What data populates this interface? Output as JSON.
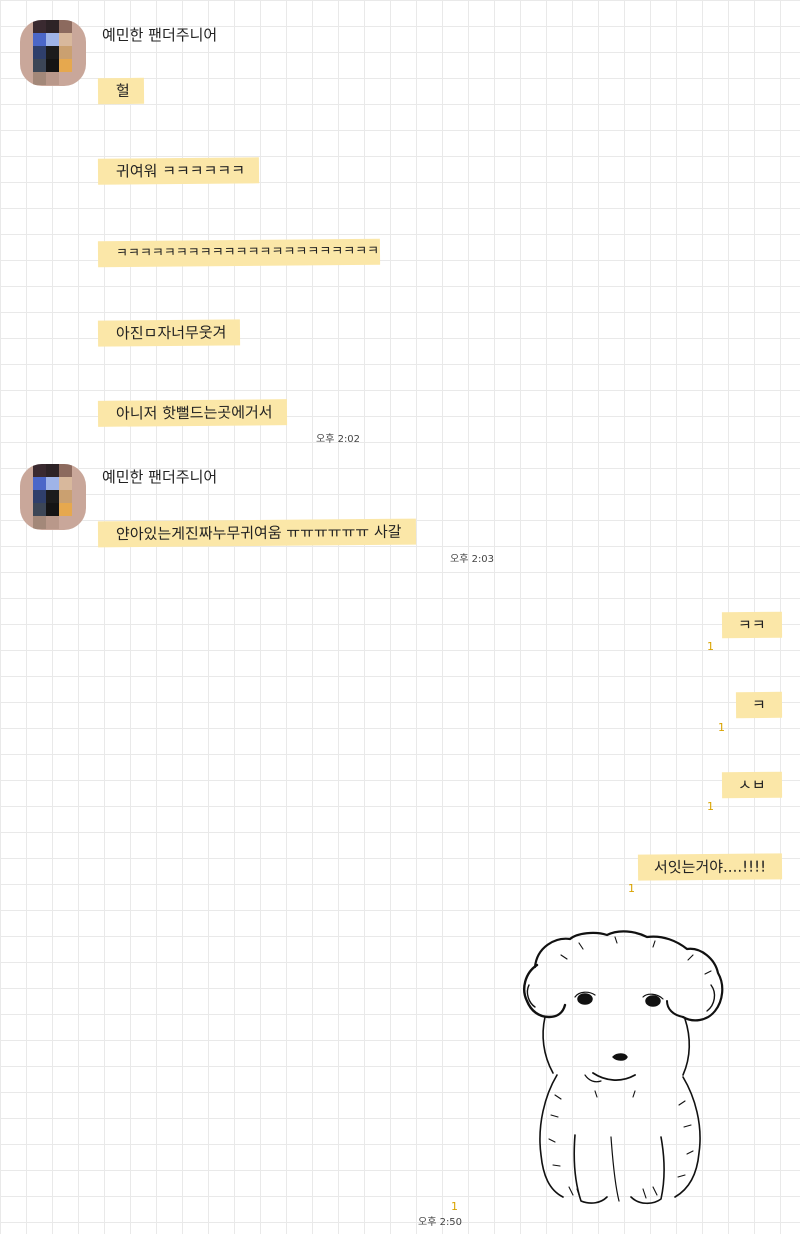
{
  "groups": [
    {
      "sender": "예민한 팬더주니어",
      "messages": [
        "헐",
        "귀여워 ㅋㅋㅋㅋㅋㅋ",
        "ㅋㅋㅋㅋㅋㅋㅋㅋㅋㅋㅋㅋㅋㅋㅋㅋㅋㅋㅋㅋㅋㅋㅋ",
        "아진ㅁ자너무웃겨",
        "아니저 핫뻘드는곳에거서"
      ],
      "time": "오후 2:02"
    },
    {
      "sender": "예민한 팬더주니어",
      "messages": [
        "얀아있는게진짜누무귀여움 ㅠㅠㅠㅠㅠㅠ 사갈"
      ],
      "time": "오후 2:03"
    }
  ],
  "my_messages": [
    {
      "text": "ㅋㅋ",
      "unread": "1"
    },
    {
      "text": "ㅋ",
      "unread": "1"
    },
    {
      "text": "ㅅㅂ",
      "unread": "1"
    },
    {
      "text": "서잇는거야....!!!!",
      "unread": "1"
    }
  ],
  "image_message": {
    "icon": "dog-drawing-image",
    "unread": "1",
    "time": "오후 2:50"
  },
  "colors": {
    "bubble": "#fbe7a8",
    "unread": "#d9a300",
    "grid": "#e9e9e9"
  }
}
